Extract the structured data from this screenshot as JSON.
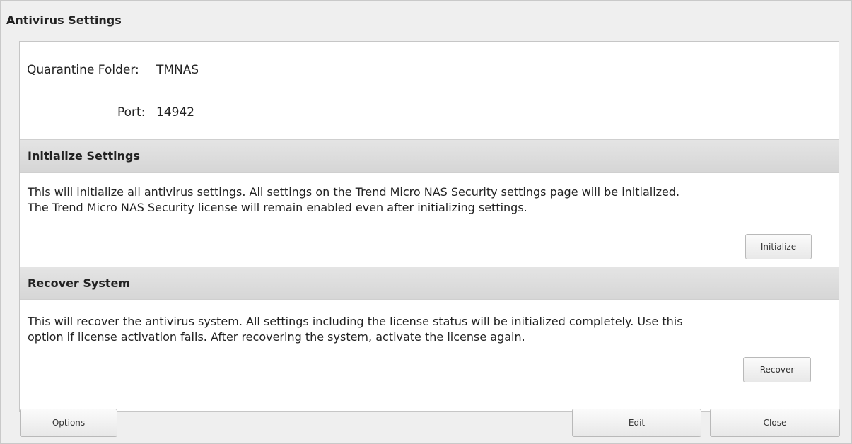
{
  "window": {
    "title": "Antivirus Settings"
  },
  "fields": {
    "quarantine_label": "Quarantine Folder:",
    "quarantine_value": "TMNAS",
    "port_label": "Port:",
    "port_value": "14942"
  },
  "initialize": {
    "header": "Initialize Settings",
    "line1": "This will initialize all antivirus settings. All settings on the Trend Micro NAS Security settings page will be initialized.",
    "line2": "The Trend Micro NAS Security license will remain enabled even after initializing settings.",
    "button_label": "Initialize"
  },
  "recover": {
    "header": "Recover System",
    "line1": "This will recover the antivirus system. All settings including the license status will be initialized completely. Use this",
    "line2": "option if license activation fails. After recovering the system, activate the license again.",
    "button_label": "Recover"
  },
  "footer": {
    "options_label": "Options",
    "edit_label": "Edit",
    "close_label": "Close"
  }
}
